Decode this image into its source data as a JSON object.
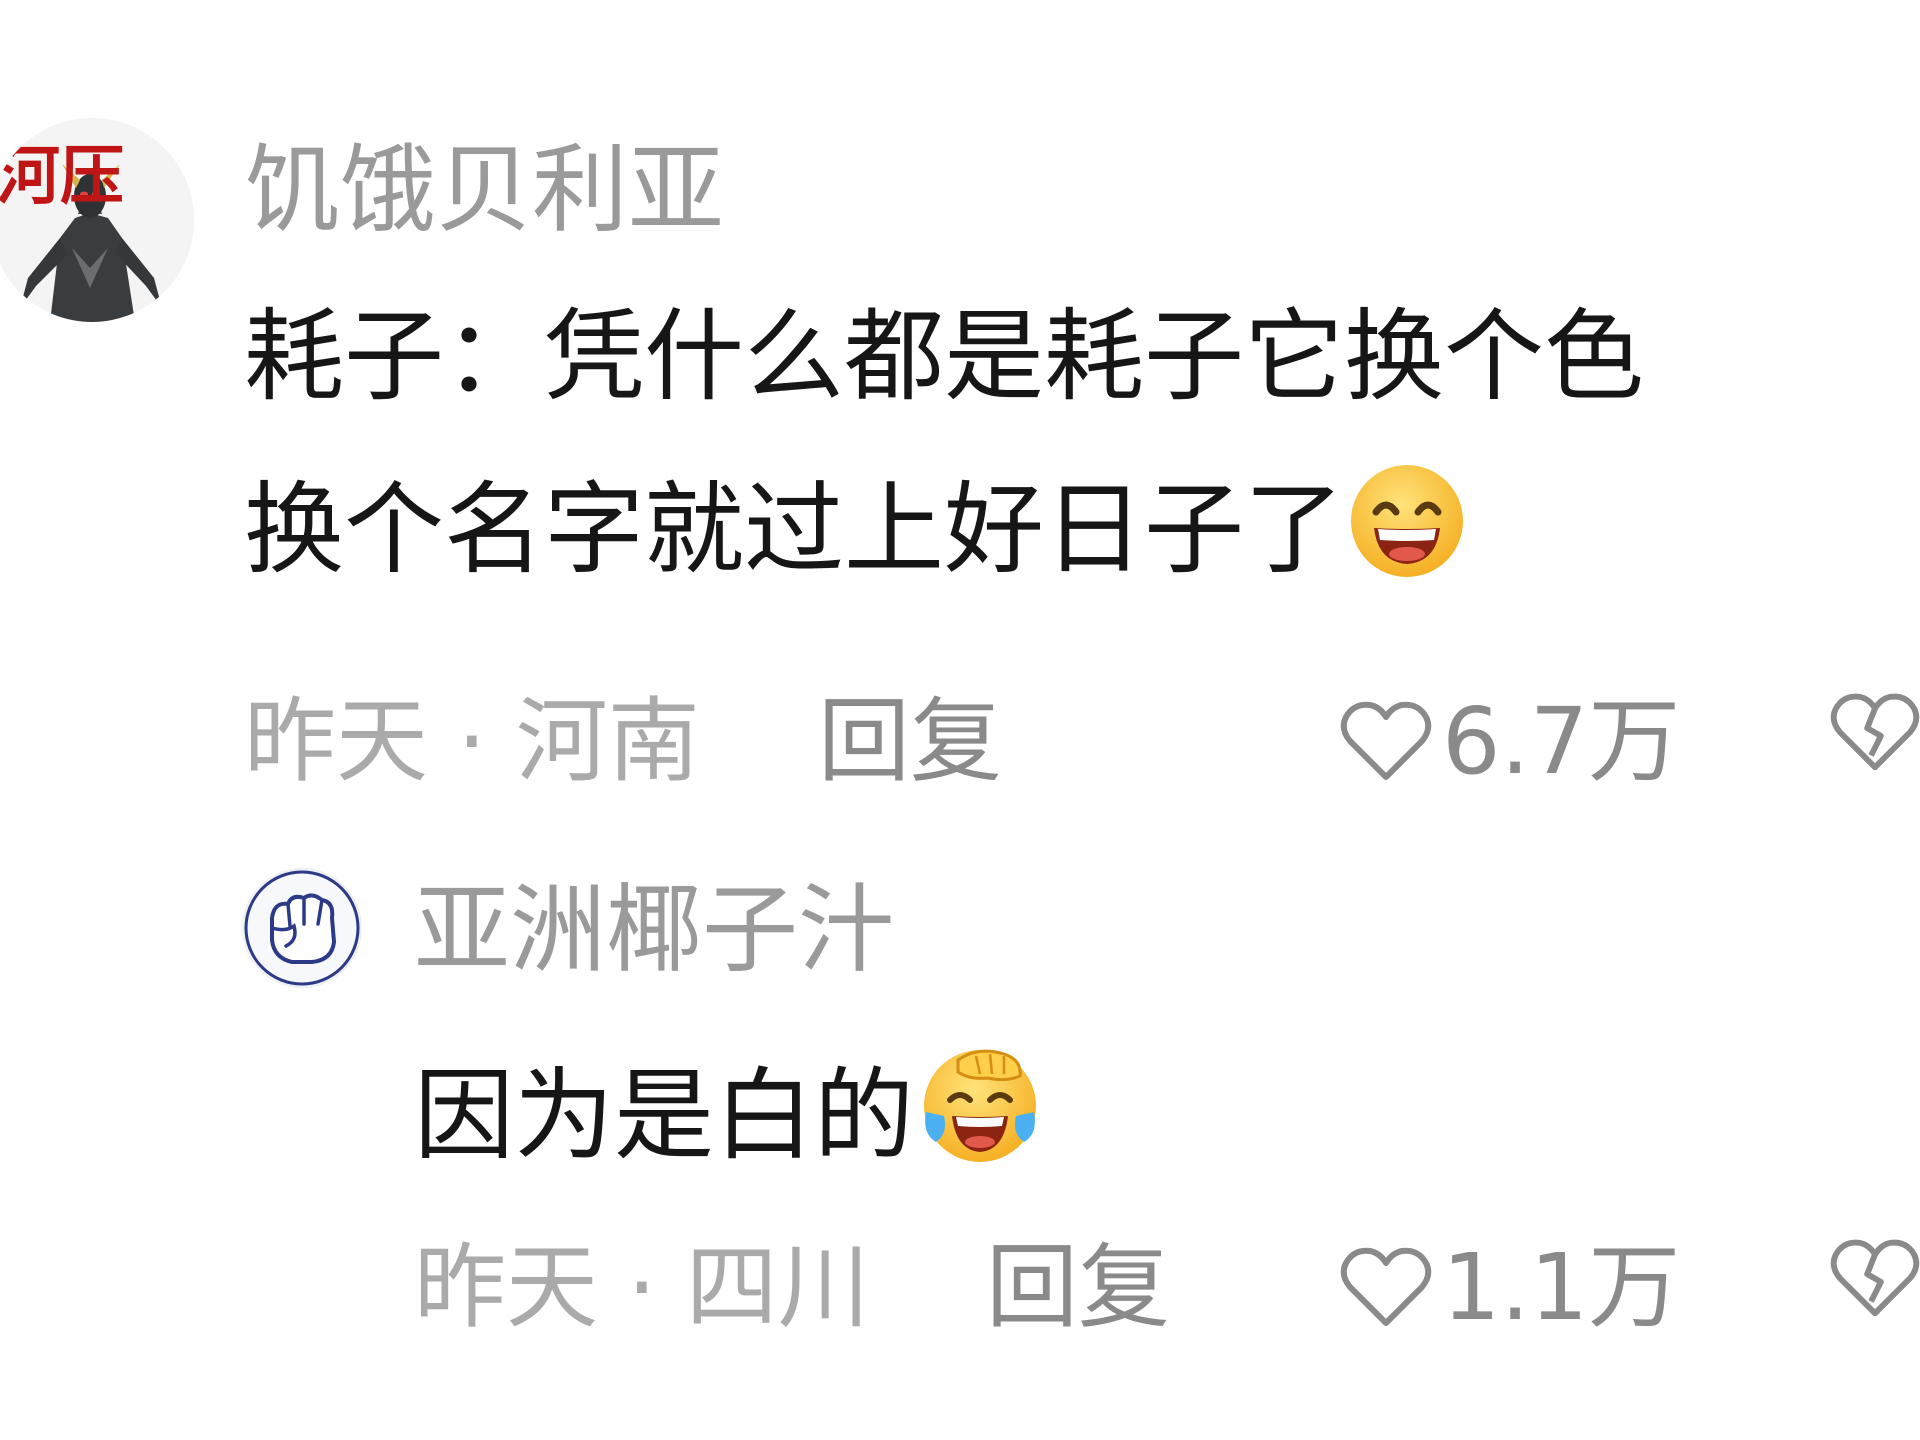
{
  "comments": [
    {
      "username": "饥饿贝利亚",
      "avatar_icon": "ultraman-belial-avatar",
      "avatar_text": "河压",
      "content_lines": [
        "耗子：凭什么都是耗子它换个色",
        "换个名字就过上好日子了"
      ],
      "emoji": "grinning-face-emoji",
      "time": "昨天",
      "separator": "·",
      "location": "河南",
      "reply_label": "回复",
      "like_count": "6.7万",
      "like_icon": "heart-icon",
      "dislike_icon": "broken-heart-icon"
    },
    {
      "username": "亚洲椰子汁",
      "avatar_icon": "fist-avatar",
      "content_lines": [
        "因为是白的"
      ],
      "emoji": "rolling-laughing-crying-emoji",
      "time": "昨天",
      "separator": "·",
      "location": "四川",
      "reply_label": "回复",
      "like_count": "1.1万",
      "like_icon": "heart-icon",
      "dislike_icon": "broken-heart-icon"
    }
  ],
  "colors": {
    "username": "#9a9a9a",
    "content": "#161616",
    "meta": "#aaaaaa",
    "action": "#8a8a8a",
    "avatar_text_red": "#c01515"
  }
}
